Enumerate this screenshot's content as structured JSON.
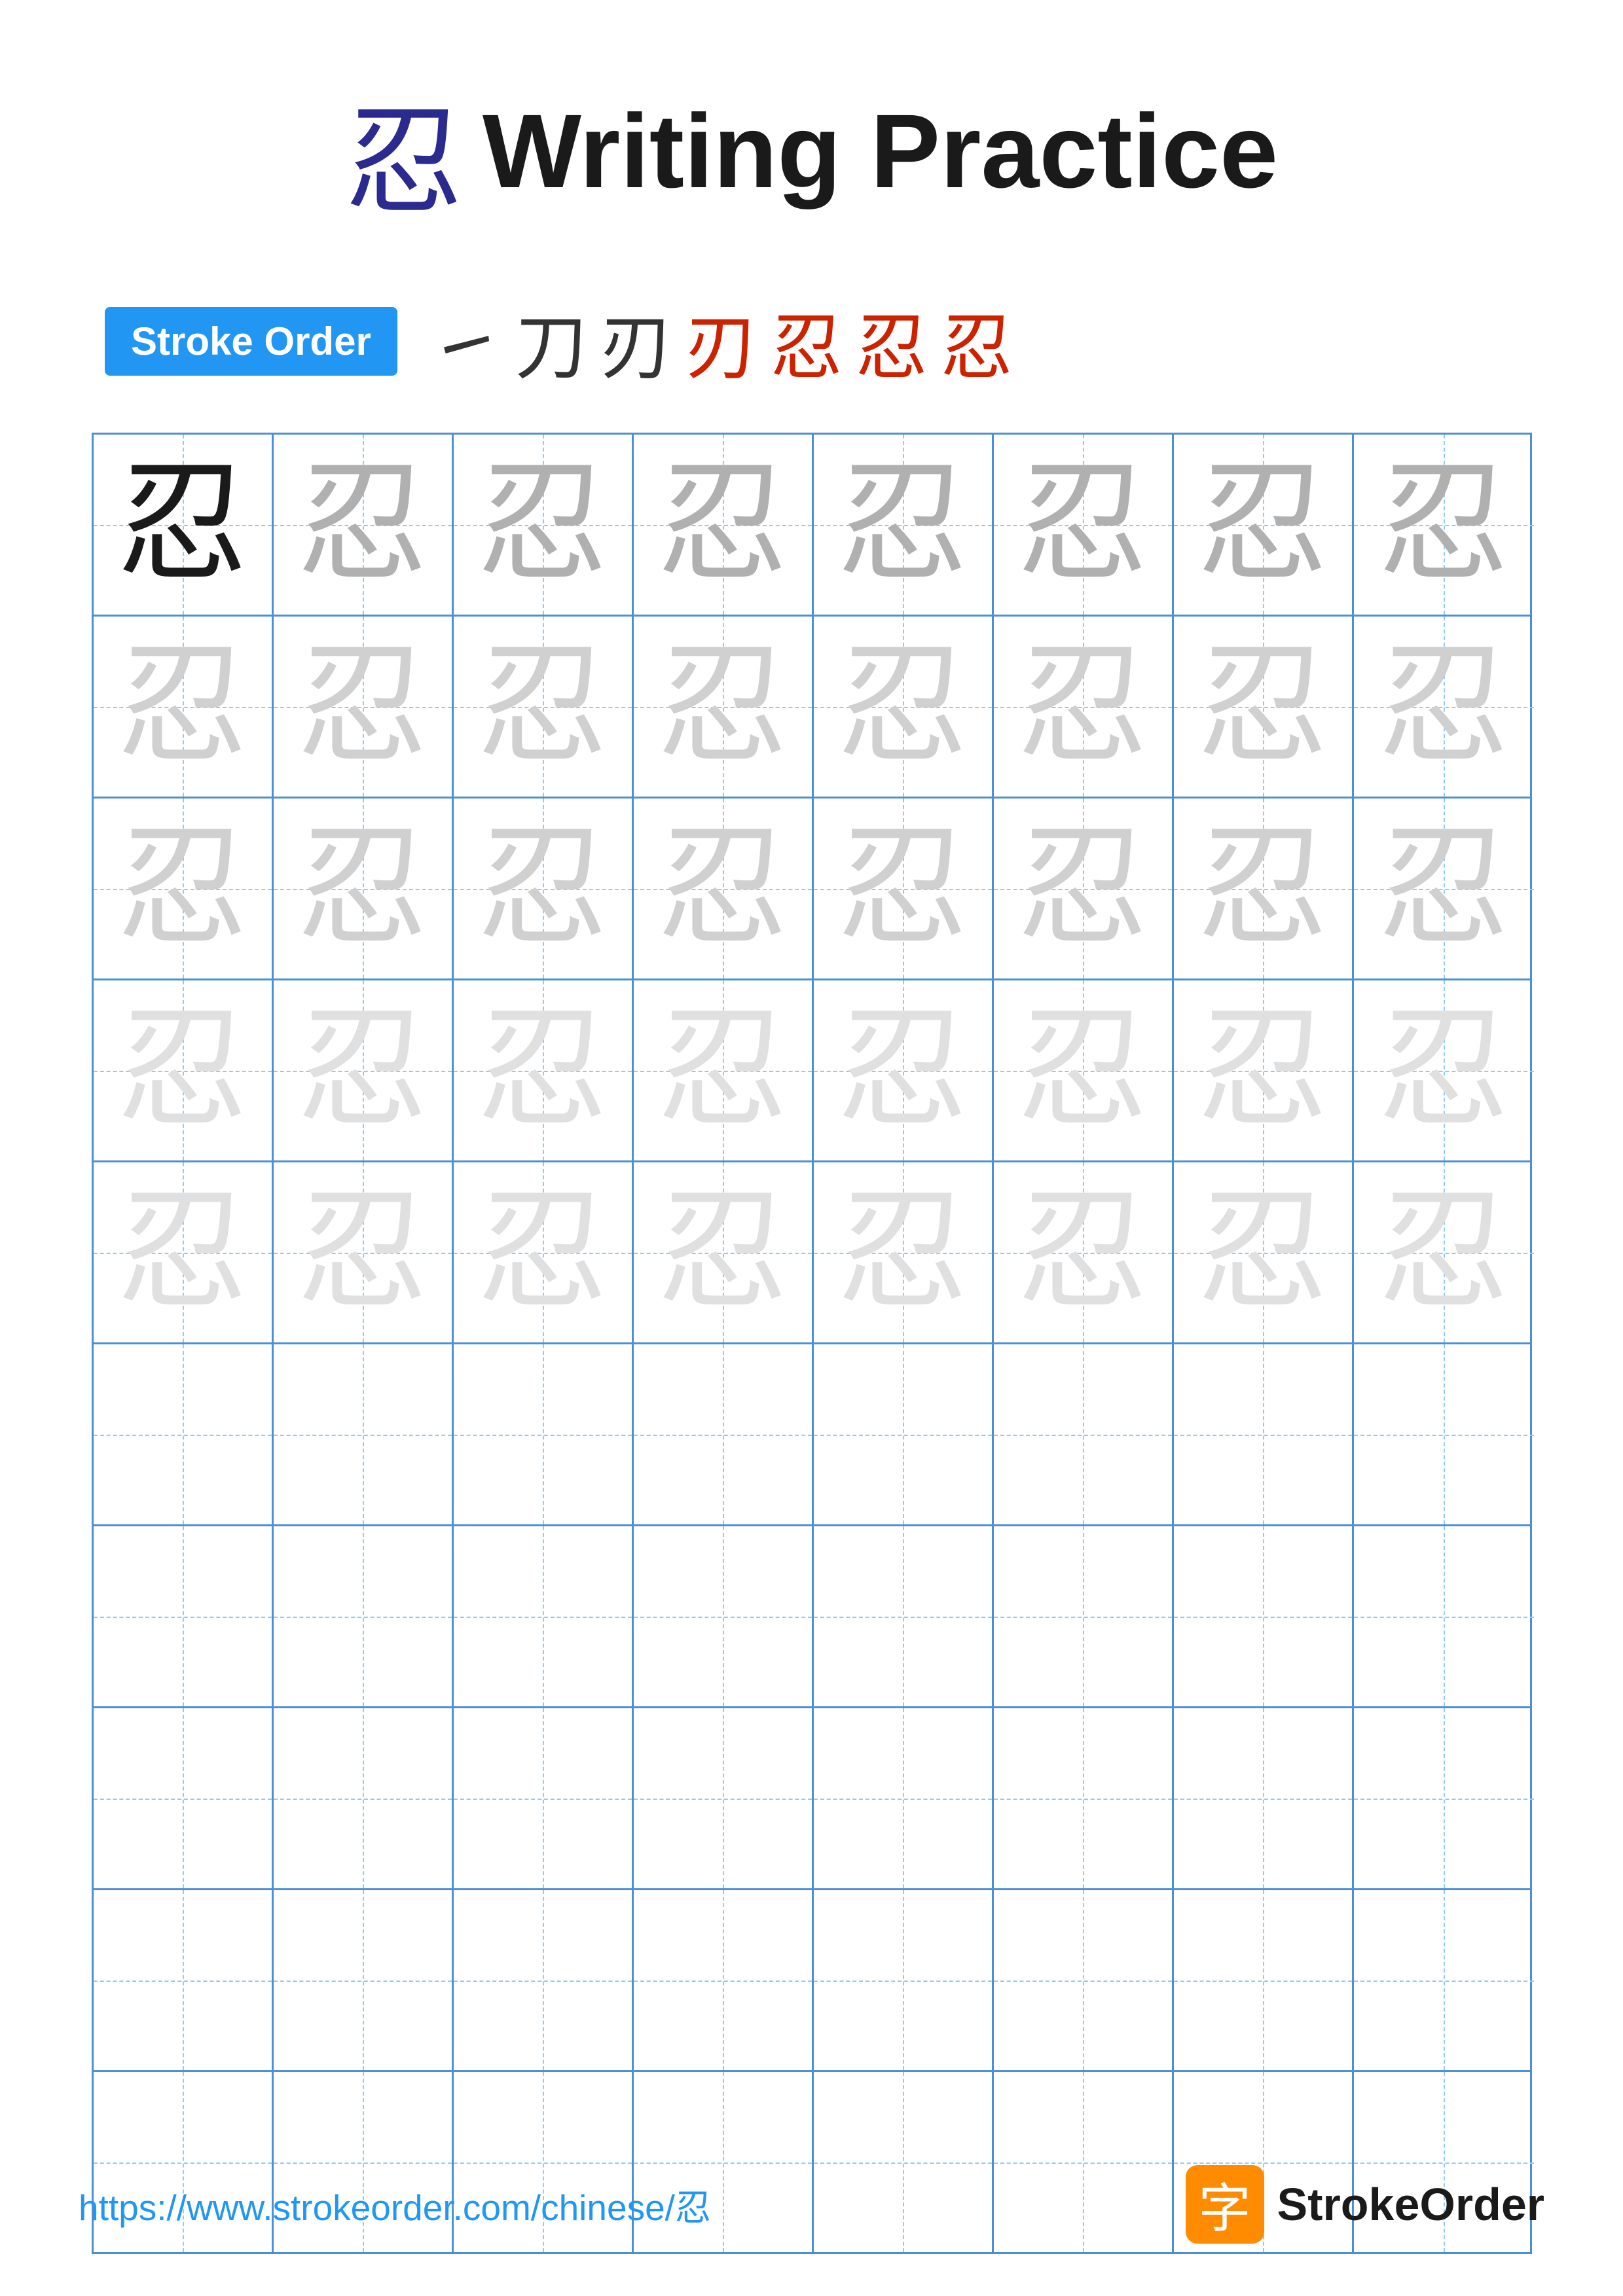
{
  "title": {
    "kanji": "忍",
    "text": "Writing Practice"
  },
  "stroke_order": {
    "badge_label": "Stroke Order",
    "steps": [
      "㇀",
      "刀",
      "刃",
      "刃",
      "忍",
      "忍",
      "忍"
    ]
  },
  "character": "忍",
  "grid": {
    "rows": 10,
    "cols": 8,
    "practice_rows_with_char": 5,
    "empty_rows": 5
  },
  "footer": {
    "url": "https://www.strokeorder.com/chinese/忍",
    "logo_char": "字",
    "logo_text": "StrokeOrder"
  }
}
